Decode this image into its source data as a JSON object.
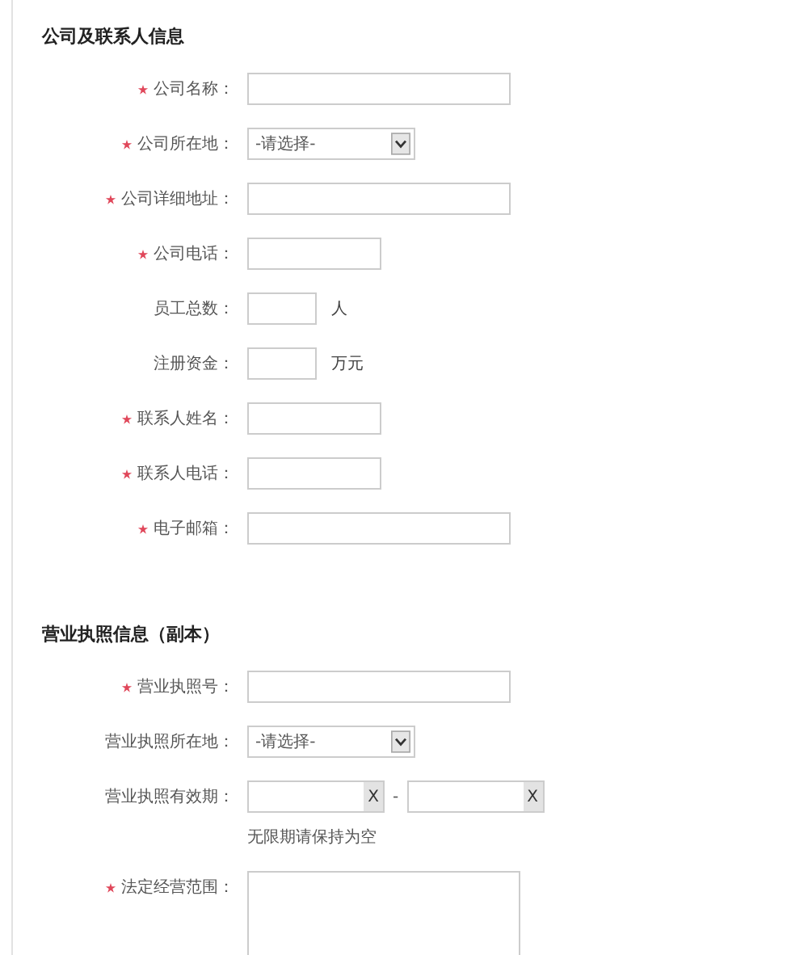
{
  "sections": [
    {
      "title": "公司及联系人信息",
      "fields": [
        {
          "kind": "wide",
          "required": true,
          "label": "公司名称："
        },
        {
          "kind": "select",
          "required": true,
          "label": "公司所在地：",
          "value": "-请选择-"
        },
        {
          "kind": "wide",
          "required": true,
          "label": "公司详细地址："
        },
        {
          "kind": "mid",
          "required": true,
          "label": "公司电话："
        },
        {
          "kind": "narrow",
          "required": false,
          "label": "员工总数：",
          "unit": "人"
        },
        {
          "kind": "narrow",
          "required": false,
          "label": "注册资金：",
          "unit": "万元"
        },
        {
          "kind": "mid",
          "required": true,
          "label": "联系人姓名："
        },
        {
          "kind": "mid",
          "required": true,
          "label": "联系人电话："
        },
        {
          "kind": "wide",
          "required": true,
          "label": "电子邮箱："
        }
      ]
    },
    {
      "title": "营业执照信息（副本）",
      "fields": [
        {
          "kind": "wide",
          "required": true,
          "label": "营业执照号："
        },
        {
          "kind": "select",
          "required": false,
          "label": "营业执照所在地：",
          "value": "-请选择-"
        },
        {
          "kind": "daterange",
          "required": false,
          "label": "营业执照有效期：",
          "clear": [
            "X",
            "X"
          ],
          "separator": "-",
          "note": "无限期请保持为空"
        },
        {
          "kind": "textarea",
          "required": true,
          "label": "法定经营范围："
        }
      ]
    }
  ]
}
